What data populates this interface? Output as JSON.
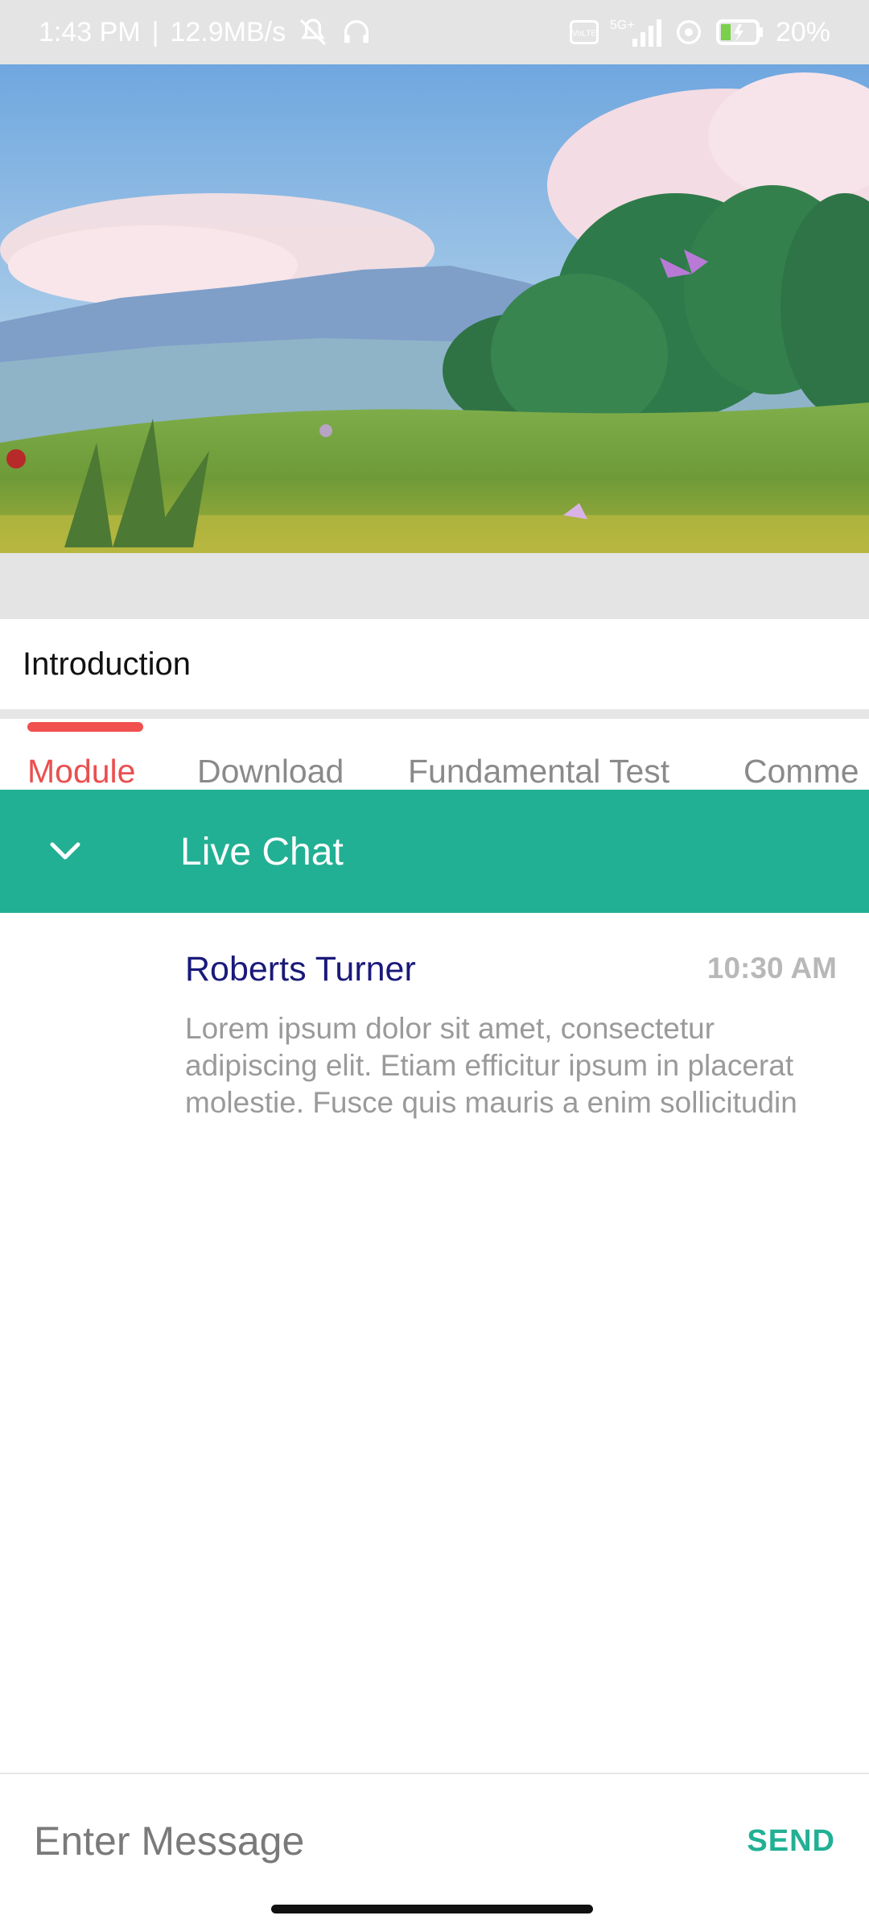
{
  "status_bar": {
    "time": "1:43 PM",
    "speed": "12.9MB/s",
    "separator": "|",
    "network": "5G+",
    "volte": "Vo LTE",
    "battery": "20%",
    "icons": [
      "mute-icon",
      "headphones-icon",
      "volte-icon",
      "signal-icon",
      "hotspot-icon",
      "battery-icon"
    ]
  },
  "video": {
    "thumbnail": "landscape-scene"
  },
  "lesson": {
    "title": "Introduction"
  },
  "tabs": [
    {
      "label": "Module",
      "active": true
    },
    {
      "label": "Download",
      "active": false
    },
    {
      "label": "Fundamental Test",
      "active": false
    },
    {
      "label": "Comme",
      "active": false
    }
  ],
  "chat": {
    "title": "Live Chat",
    "messages": [
      {
        "name": "Roberts Turner",
        "time": "10:30 AM",
        "text": "Lorem ipsum dolor sit amet, consectetur adipiscing elit. Etiam efficitur ipsum in placerat molestie. Fusce quis mauris a enim sollicitudin"
      }
    ],
    "input_placeholder": "Enter Message",
    "send_label": "SEND"
  },
  "colors": {
    "accent": "#22b094",
    "tab_active": "#ea4f4f",
    "name": "#1a1a7a"
  }
}
